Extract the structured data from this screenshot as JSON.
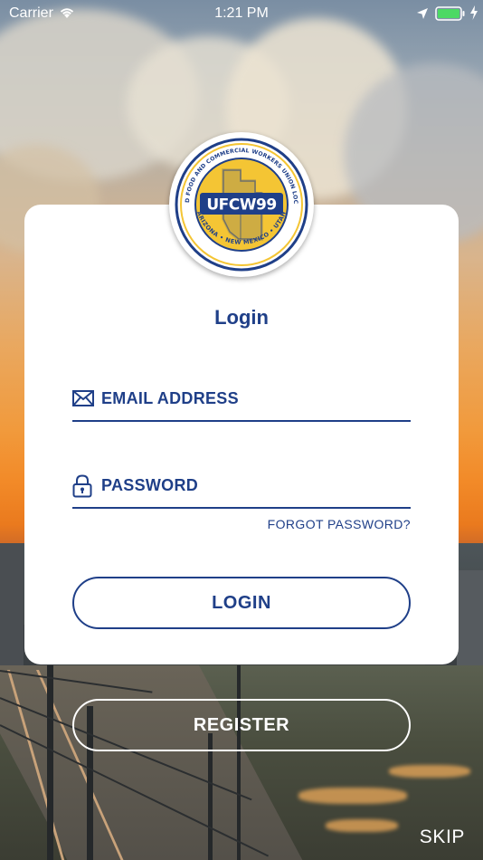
{
  "status_bar": {
    "carrier": "Carrier",
    "time": "1:21 PM"
  },
  "logo": {
    "name": "UFCW99",
    "ring_top_text": "UNITED FOOD AND COMMERCIAL WORKERS UNION LOCAL 99",
    "ring_bottom_text": "ARIZONA • NEW MEXICO • UTAH",
    "colors": {
      "navy": "#1f3f88",
      "gold": "#f4c534"
    }
  },
  "login": {
    "title": "Login",
    "email_placeholder": "EMAIL ADDRESS",
    "password_placeholder": "PASSWORD",
    "forgot_label": "FORGOT PASSWORD?",
    "login_label": "LOGIN"
  },
  "register_label": "REGISTER",
  "skip_label": "SKIP",
  "icons": [
    "wifi-icon",
    "location-icon",
    "battery-icon",
    "charge-icon",
    "envelope-icon",
    "padlock-icon"
  ],
  "colors": {
    "accent": "#1f3f88",
    "battery": "#4cd964"
  }
}
